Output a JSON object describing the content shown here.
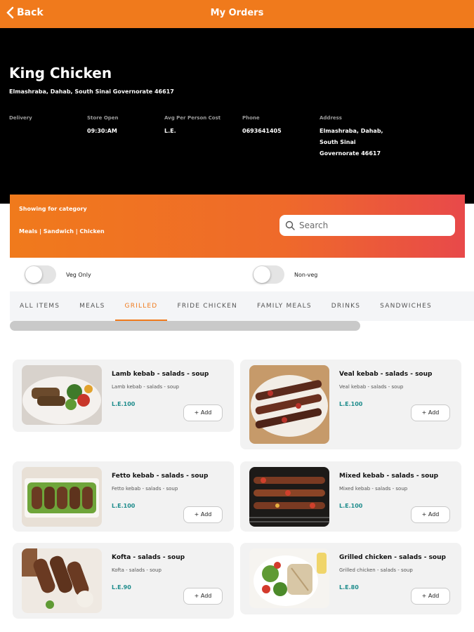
{
  "topbar": {
    "back_label": "Back",
    "title": "My Orders"
  },
  "restaurant": {
    "name": "King Chicken",
    "address": "Elmashraba, Dahab, South Sinai Governorate 46617",
    "info": [
      {
        "label": "Delivery",
        "value": ""
      },
      {
        "label": "Store Open",
        "value": "09:30:AM"
      },
      {
        "label": "Avg Per Person Cost",
        "value": "L.E."
      },
      {
        "label": "Phone",
        "value": "0693641405"
      },
      {
        "label": "Address",
        "value": "Elmashraba, Dahab, South Sinai Governorate 46617"
      }
    ]
  },
  "category_banner": {
    "showing_label": "Showing for category",
    "categories": "Meals | Sandwich | Chicken",
    "search_placeholder": "Search"
  },
  "filters": {
    "veg_only": {
      "label": "Veg Only",
      "on": false
    },
    "non_veg": {
      "label": "Non-veg",
      "on": false
    }
  },
  "tabs": [
    "ALL ITEMS",
    "MEALS",
    "GRILLED",
    "FRIDE CHICKEN",
    "FAMILY MEALS",
    "DRINKS",
    "SANDWICHES"
  ],
  "active_tab": "GRILLED",
  "products": [
    {
      "title": "Lamb kebab - salads - soup",
      "subtitle": "Lamb kebab - salads - soup",
      "price": "L.E.100",
      "add_label": "+ Add",
      "image": "lamb-kebab-photo"
    },
    {
      "title": "Veal kebab - salads - soup",
      "subtitle": "Veal kebab - salads - soup",
      "price": "L.E.100",
      "add_label": "+ Add",
      "image": "veal-kebab-photo"
    },
    {
      "title": "Fetto kebab - salads - soup",
      "subtitle": "Fetto kebab - salads - soup",
      "price": "L.E.100",
      "add_label": "+ Add",
      "image": "fetto-kebab-photo"
    },
    {
      "title": "Mixed kebab - salads - soup",
      "subtitle": "Mixed kebab - salads - soup",
      "price": "L.E.100",
      "add_label": "+ Add",
      "image": "mixed-kebab-photo"
    },
    {
      "title": "Kofta - salads - soup",
      "subtitle": "Kofta - salads - soup",
      "price": "L.E.90",
      "add_label": "+ Add",
      "image": "kofta-photo"
    },
    {
      "title": "Grilled chicken - salads - soup",
      "subtitle": "Grilled chicken - salads - soup",
      "price": "L.E.80",
      "add_label": "+ Add",
      "image": "grilled-chicken-photo"
    }
  ],
  "colors": {
    "brand_orange": "#f07a1c",
    "banner_end": "#e8494a",
    "price_teal": "#1e8c8c",
    "header_bg": "#000000"
  }
}
